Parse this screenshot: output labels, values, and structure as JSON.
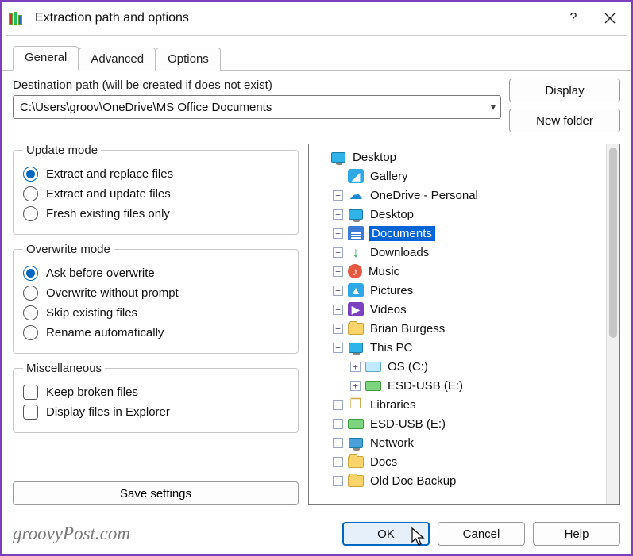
{
  "title": "Extraction path and options",
  "tabs": {
    "general": "General",
    "advanced": "Advanced",
    "options": "Options"
  },
  "dest_label": "Destination path (will be created if does not exist)",
  "dest_path": "C:\\Users\\groov\\OneDrive\\MS Office Documents",
  "buttons": {
    "display": "Display",
    "newfolder": "New folder",
    "save": "Save settings",
    "ok": "OK",
    "cancel": "Cancel",
    "help": "Help"
  },
  "groups": {
    "update": {
      "legend": "Update mode",
      "o1": "Extract and replace files",
      "o2": "Extract and update files",
      "o3": "Fresh existing files only"
    },
    "overwrite": {
      "legend": "Overwrite mode",
      "o1": "Ask before overwrite",
      "o2": "Overwrite without prompt",
      "o3": "Skip existing files",
      "o4": "Rename automatically"
    },
    "misc": {
      "legend": "Miscellaneous",
      "o1": "Keep broken files",
      "o2": "Display files in Explorer"
    }
  },
  "tree": [
    {
      "indent": 0,
      "exp": "none",
      "icon": "monitor",
      "label": "Desktop"
    },
    {
      "indent": 1,
      "exp": "none",
      "icon": "gallery",
      "label": "Gallery"
    },
    {
      "indent": 1,
      "exp": "+",
      "icon": "cloud",
      "label": "OneDrive - Personal"
    },
    {
      "indent": 1,
      "exp": "+",
      "icon": "monitor",
      "label": "Desktop"
    },
    {
      "indent": 1,
      "exp": "+",
      "icon": "doc",
      "label": "Documents",
      "selected": true
    },
    {
      "indent": 1,
      "exp": "+",
      "icon": "down",
      "label": "Downloads"
    },
    {
      "indent": 1,
      "exp": "+",
      "icon": "music",
      "label": "Music"
    },
    {
      "indent": 1,
      "exp": "+",
      "icon": "pic",
      "label": "Pictures"
    },
    {
      "indent": 1,
      "exp": "+",
      "icon": "vid",
      "label": "Videos"
    },
    {
      "indent": 1,
      "exp": "+",
      "icon": "folder",
      "label": "Brian Burgess"
    },
    {
      "indent": 1,
      "exp": "-",
      "icon": "pc",
      "label": "This PC"
    },
    {
      "indent": 2,
      "exp": "+",
      "icon": "drive",
      "label": "OS (C:)"
    },
    {
      "indent": 2,
      "exp": "+",
      "icon": "usb",
      "label": "ESD-USB (E:)"
    },
    {
      "indent": 1,
      "exp": "+",
      "icon": "lib",
      "label": "Libraries"
    },
    {
      "indent": 1,
      "exp": "+",
      "icon": "usb",
      "label": "ESD-USB (E:)"
    },
    {
      "indent": 1,
      "exp": "+",
      "icon": "net",
      "label": "Network"
    },
    {
      "indent": 1,
      "exp": "+",
      "icon": "folder",
      "label": "Docs"
    },
    {
      "indent": 1,
      "exp": "+",
      "icon": "folder",
      "label": "Old Doc Backup"
    }
  ],
  "watermark": "groovyPost.com"
}
